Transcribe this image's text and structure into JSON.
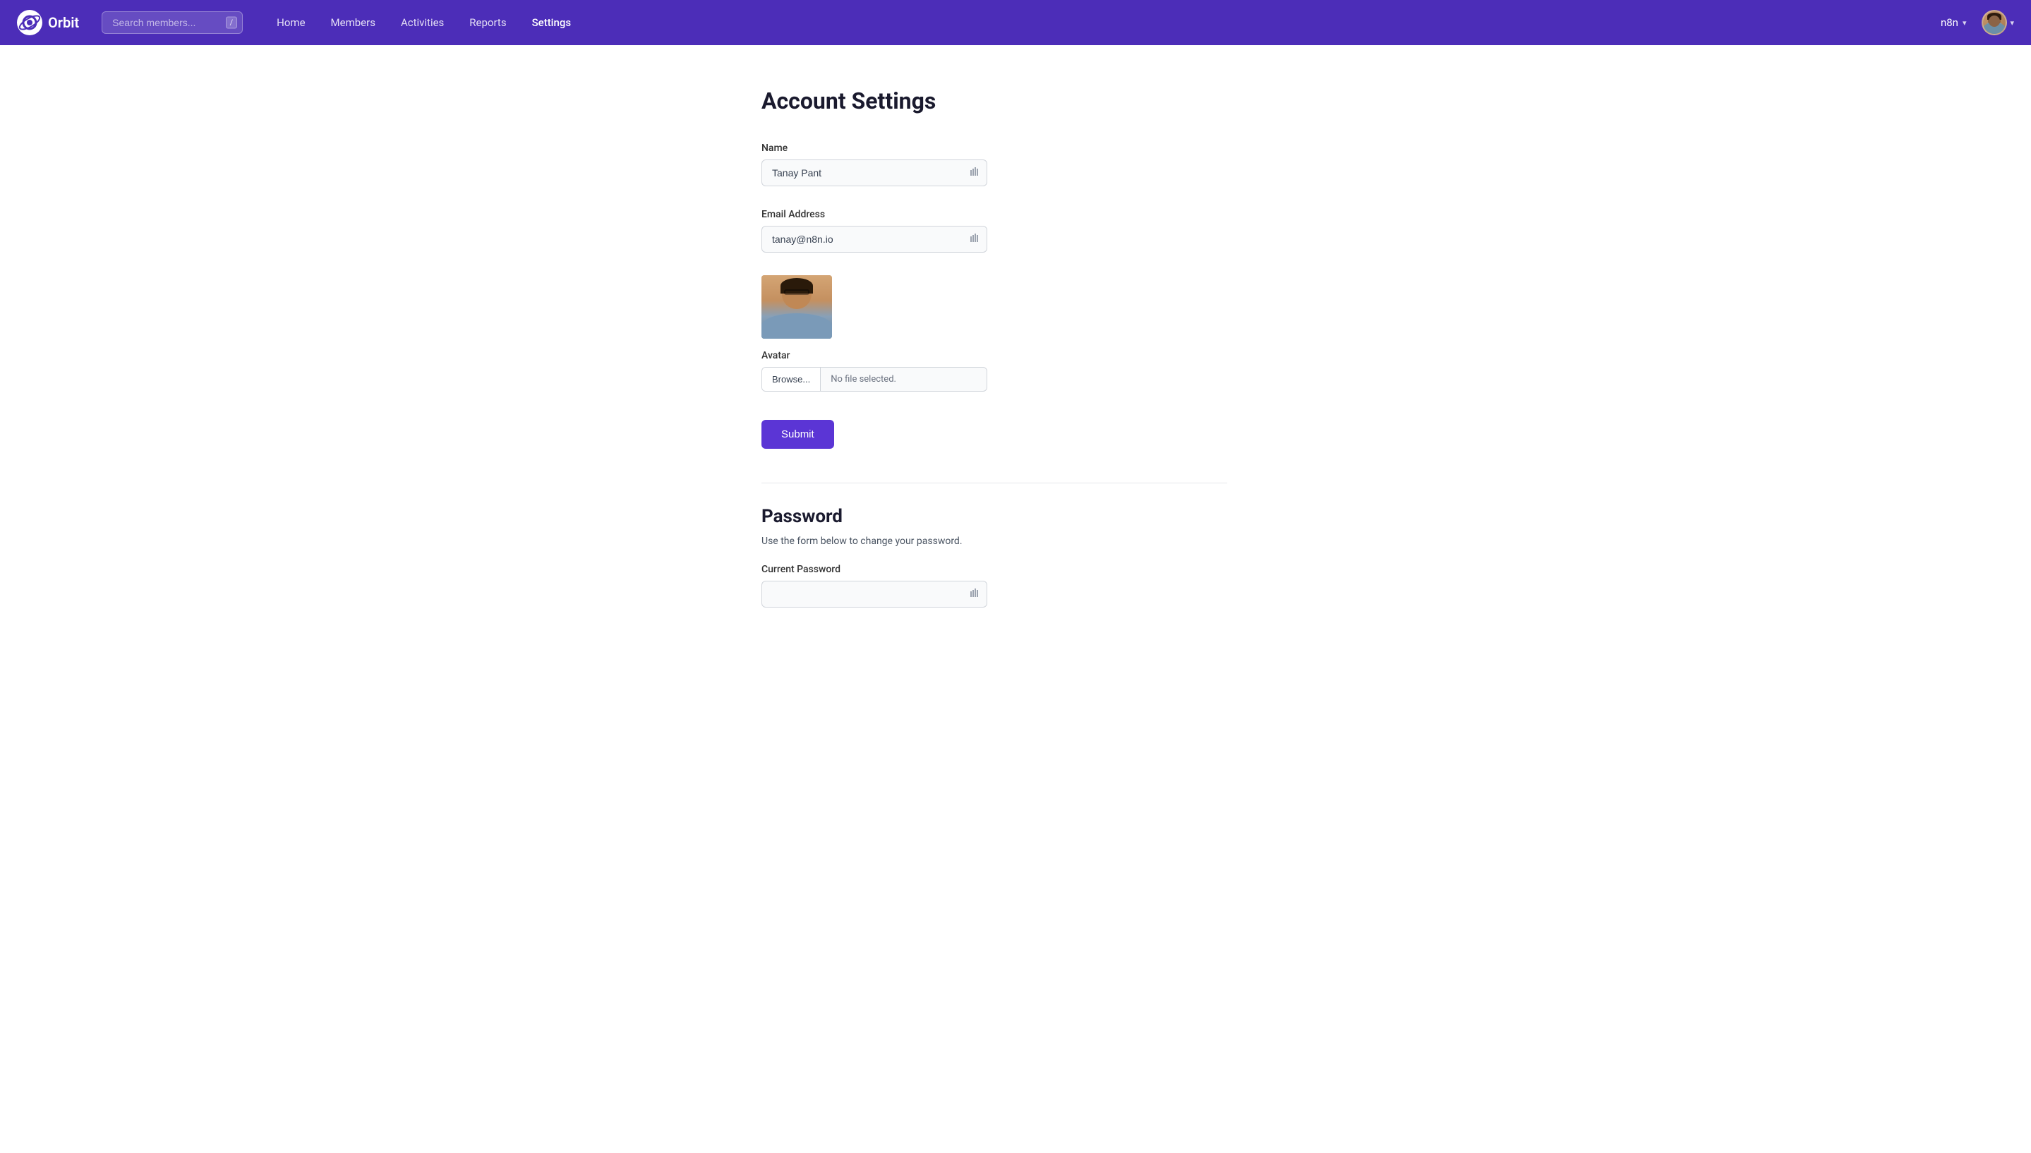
{
  "navbar": {
    "logo_text": "Orbit",
    "search_placeholder": "Search members...",
    "search_shortcut": "/",
    "links": [
      {
        "id": "home",
        "label": "Home",
        "active": false
      },
      {
        "id": "members",
        "label": "Members",
        "active": false
      },
      {
        "id": "activities",
        "label": "Activities",
        "active": false
      },
      {
        "id": "reports",
        "label": "Reports",
        "active": false
      },
      {
        "id": "settings",
        "label": "Settings",
        "active": true
      }
    ],
    "workspace": "n8n",
    "chevron": "▾"
  },
  "page": {
    "title": "Account Settings",
    "name_label": "Name",
    "name_value": "Tanay Pant",
    "email_label": "Email Address",
    "email_value": "tanay@n8n.io",
    "avatar_section_label": "Avatar",
    "browse_button_label": "Browse...",
    "file_selected_text": "No file selected.",
    "submit_label": "Submit",
    "password_title": "Password",
    "password_description": "Use the form below to change your password.",
    "current_password_label": "Current Password"
  }
}
